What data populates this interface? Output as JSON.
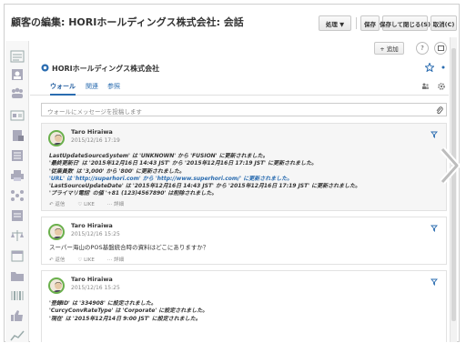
{
  "window": {
    "title": "顧客の編集: HORIホールディングス株式会社: 会話",
    "buttons": {
      "actions_label": "処理 ▼",
      "save_label": "保存",
      "save_close_label": "保存して閉じる(S)",
      "cancel_label": "取消(C)"
    }
  },
  "toolbar": {
    "add_label": "+ 追加",
    "help_label": "?",
    "expand_label": ""
  },
  "company": {
    "name": "HORIホールディングス株式会社"
  },
  "tabs": [
    {
      "label": "ウォール",
      "active": true
    },
    {
      "label": "関連",
      "active": false
    },
    {
      "label": "参照",
      "active": false
    }
  ],
  "postbox": {
    "placeholder": "ウォールにメッセージを投稿します"
  },
  "posts": [
    {
      "author": "Taro Hiraiwa",
      "date": "2015/12/16 17:19",
      "lines": [
        "LastUpdateSourceSystem' は 'UNKNOWN' から 'FUSION' に更新されました。",
        "'最終更新日' は '2015年12月16日 14:43 JST' から '2015年12月16日 17:19 JST' に更新されました。",
        "'従業員数' は '3,000' から '800' に更新されました。",
        "'URL' は 'http://superhori.com' から 'http://www.superhori.com/' に更新されました。",
        "'LastSourceUpdateDate' は '2015年12月16日 14:43 JST' から '2015年12月16日 17:19 JST' に更新されました。",
        "'プライマリ電話' の値 '+81 (123)4567890' は削除されました。"
      ]
    },
    {
      "author": "Taro Hiraiwa",
      "date": "2015/12/16 15:25",
      "lines": [
        "スーパー海山のPOS基盤統合時の資料はどこにありますか？"
      ]
    },
    {
      "author": "Taro Hiraiwa",
      "date": "2015/12/16 15:25",
      "lines": [
        "'登録ID' は '334908' に設定されました。",
        "'CurcyConvRateType' は 'Corporate' に設定されました。",
        "'現在' は '2015年12月14日 9:00 JST' に設定されました。"
      ]
    }
  ],
  "post_actions": {
    "reply": "返信",
    "like": "LIKE",
    "more": "詳細"
  }
}
